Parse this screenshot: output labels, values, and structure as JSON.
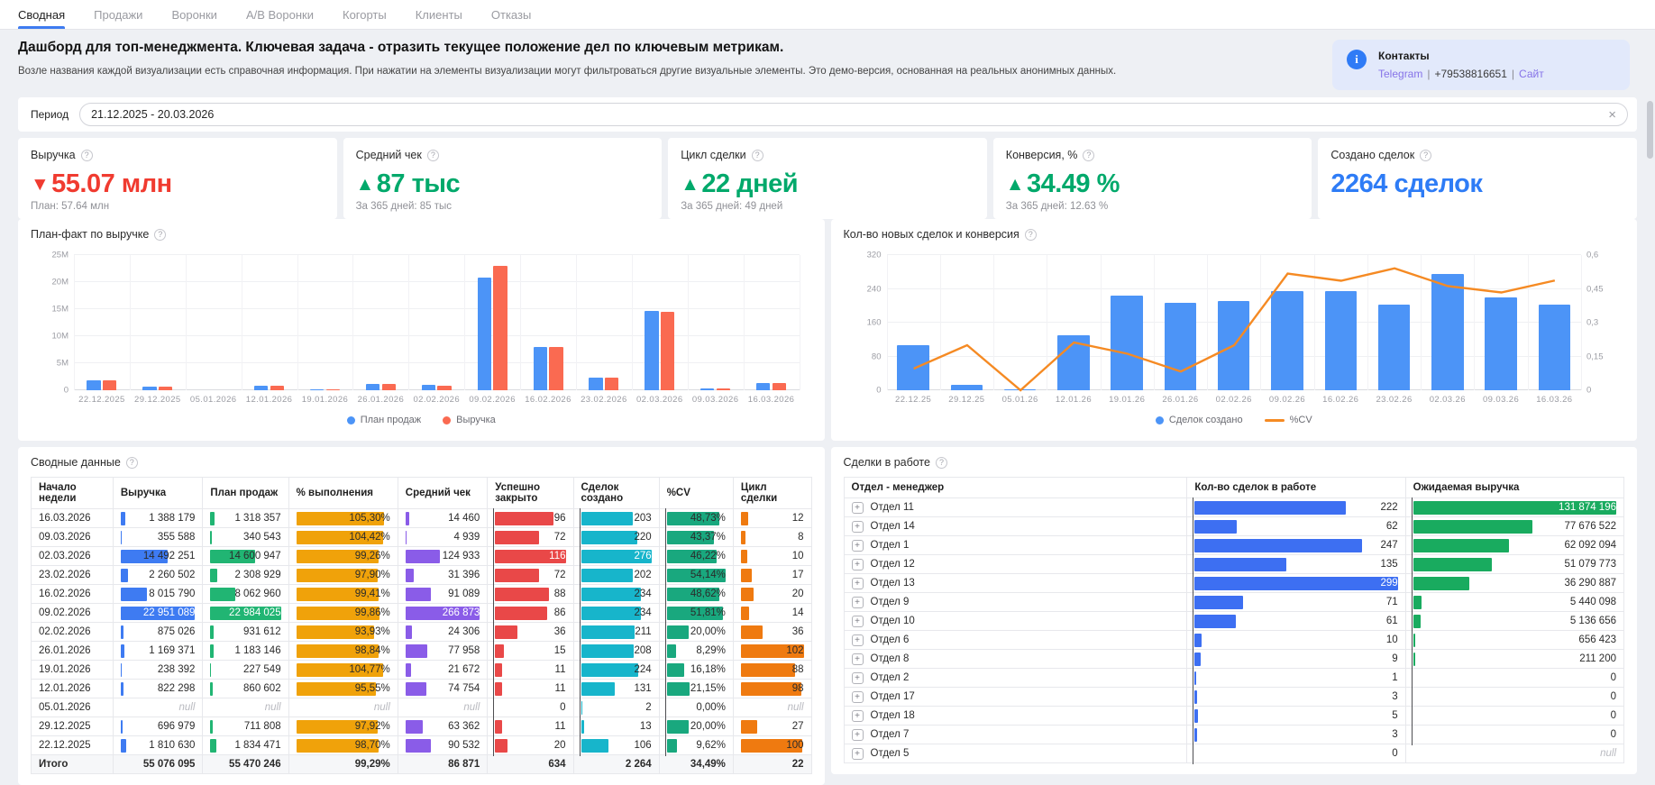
{
  "tabs": [
    {
      "id": "svodnaya",
      "label": "Сводная",
      "active": true
    },
    {
      "id": "prodazhi",
      "label": "Продажи",
      "active": false
    },
    {
      "id": "voronki",
      "label": "Воронки",
      "active": false
    },
    {
      "id": "ab-voronki",
      "label": "А/В Воронки",
      "active": false
    },
    {
      "id": "kogorty",
      "label": "Когорты",
      "active": false
    },
    {
      "id": "klienty",
      "label": "Клиенты",
      "active": false
    },
    {
      "id": "otkazy",
      "label": "Отказы",
      "active": false
    }
  ],
  "header": {
    "title": "Дашборд для топ-менеджмента. Ключевая задача - отразить текущее положение дел по ключевым метрикам.",
    "subtitle": "Возле названия каждой визуализации есть справочная информация. При нажатии на элементы визуализации могут фильтроваться другие визуальные элементы. Это демо-версия, основанная на реальных анонимных данных.",
    "contacts": {
      "title": "Контакты",
      "telegram": "Telegram",
      "phone": "+79538816651",
      "site": "Сайт"
    }
  },
  "filter": {
    "label": "Период",
    "value": "21.12.2025 - 20.03.2026"
  },
  "kpis": [
    {
      "id": "revenue",
      "title": "Выручка",
      "arrow": "▼",
      "value": "55.07 млн",
      "color": "#f03b30",
      "sub": "План: 57.64 млн"
    },
    {
      "id": "avg-check",
      "title": "Средний чек",
      "arrow": "▲",
      "value": "87 тыс",
      "color": "#00a96b",
      "sub": "За 365 дней: 85 тыс"
    },
    {
      "id": "deal-cycle",
      "title": "Цикл сделки",
      "arrow": "▲",
      "value": "22 дней",
      "color": "#00a96b",
      "sub": "За 365 дней: 49 дней"
    },
    {
      "id": "conversion",
      "title": "Конверсия, %",
      "arrow": "▲",
      "value": "34.49 %",
      "color": "#00a96b",
      "sub": "За 365 дней: 12.63 %"
    },
    {
      "id": "deals-created",
      "title": "Создано сделок",
      "arrow": "",
      "value": "2264 сделок",
      "color": "#2e7cf6",
      "sub": ""
    }
  ],
  "chart_data": [
    {
      "type": "bar",
      "title": "План-факт по выручке",
      "categories": [
        "22.12.2025",
        "29.12.2025",
        "05.01.2026",
        "12.01.2026",
        "19.01.2026",
        "26.01.2026",
        "02.02.2026",
        "09.02.2026",
        "16.02.2026",
        "23.02.2026",
        "02.03.2026",
        "09.03.2026",
        "16.03.2026"
      ],
      "series": [
        {
          "name": "План продаж",
          "kind": "bar",
          "color": "#4c94f7",
          "values": [
            1834471,
            711808,
            0,
            860602,
            227549,
            1183146,
            931612,
            20900000,
            8062960,
            2308929,
            14600947,
            340543,
            1318357
          ]
        },
        {
          "name": "Выручка",
          "kind": "bar",
          "color": "#fa6a51",
          "values": [
            1810630,
            696979,
            0,
            822298,
            238392,
            1169371,
            875026,
            22951089,
            8015790,
            2260502,
            14492251,
            355588,
            1388179
          ]
        }
      ],
      "ylim_left": [
        0,
        25000000
      ],
      "yticks_left": [
        "0",
        "5M",
        "10M",
        "15M",
        "20M",
        "25M"
      ],
      "grid": true,
      "legend_position": "bottom"
    },
    {
      "type": "bar+line",
      "title": "Кол-во новых сделок и конверсия",
      "categories": [
        "22.12.25",
        "29.12.25",
        "05.01.26",
        "12.01.26",
        "19.01.26",
        "26.01.26",
        "02.02.26",
        "09.02.26",
        "16.02.26",
        "23.02.26",
        "02.03.26",
        "09.03.26",
        "16.03.26"
      ],
      "series": [
        {
          "name": "Сделок создано",
          "kind": "bar",
          "color": "#4c94f7",
          "axis": "left",
          "values": [
            106,
            13,
            2,
            131,
            224,
            208,
            211,
            234,
            234,
            202,
            276,
            220,
            203
          ]
        },
        {
          "name": "%CV",
          "kind": "line",
          "color": "#f58a23",
          "axis": "right",
          "values": [
            0.096,
            0.2,
            0,
            0.212,
            0.162,
            0.083,
            0.2,
            0.518,
            0.486,
            0.541,
            0.462,
            0.434,
            0.487
          ]
        }
      ],
      "ylim_left": [
        0,
        320
      ],
      "yticks_left": [
        "0",
        "80",
        "160",
        "240",
        "320"
      ],
      "ylim_right": [
        0,
        0.6
      ],
      "yticks_right": [
        "0",
        "0,15",
        "0,3",
        "0,45",
        "0,6"
      ],
      "grid": true,
      "legend_position": "bottom"
    }
  ],
  "tables": {
    "summary": {
      "title": "Сводные данные",
      "columns": [
        "Начало недели",
        "Выручка",
        "План продаж",
        "% выполнения",
        "Средний чек",
        "Успешно закрыто",
        "Сделок создано",
        "%CV",
        "Цикл сделки"
      ],
      "rows": [
        [
          "16.03.2026",
          "1 388 179",
          "1 318 357",
          "105,30%",
          "14 460",
          "96",
          "203",
          "48,73%",
          "12"
        ],
        [
          "09.03.2026",
          "355 588",
          "340 543",
          "104,42%",
          "4 939",
          "72",
          "220",
          "43,37%",
          "8"
        ],
        [
          "02.03.2026",
          "14 492 251",
          "14 600 947",
          "99,26%",
          "124 933",
          "116",
          "276",
          "46,22%",
          "10"
        ],
        [
          "23.02.2026",
          "2 260 502",
          "2 308 929",
          "97,90%",
          "31 396",
          "72",
          "202",
          "54,14%",
          "17"
        ],
        [
          "16.02.2026",
          "8 015 790",
          "8 062 960",
          "99,41%",
          "91 089",
          "88",
          "234",
          "48,62%",
          "20"
        ],
        [
          "09.02.2026",
          "22 951 089",
          "22 984 025",
          "99,86%",
          "266 873",
          "86",
          "234",
          "51,81%",
          "14"
        ],
        [
          "02.02.2026",
          "875 026",
          "931 612",
          "93,93%",
          "24 306",
          "36",
          "211",
          "20,00%",
          "36"
        ],
        [
          "26.01.2026",
          "1 169 371",
          "1 183 146",
          "98,84%",
          "77 958",
          "15",
          "208",
          "8,29%",
          "102"
        ],
        [
          "19.01.2026",
          "238 392",
          "227 549",
          "104,77%",
          "21 672",
          "11",
          "224",
          "16,18%",
          "88"
        ],
        [
          "12.01.2026",
          "822 298",
          "860 602",
          "95,55%",
          "74 754",
          "11",
          "131",
          "21,15%",
          "98"
        ],
        [
          "05.01.2026",
          "null",
          "null",
          "null",
          "null",
          "0",
          "2",
          "0,00%",
          "null"
        ],
        [
          "29.12.2025",
          "696 979",
          "711 808",
          "97,92%",
          "63 362",
          "11",
          "13",
          "20,00%",
          "27"
        ],
        [
          "22.12.2025",
          "1 810 630",
          "1 834 471",
          "98,70%",
          "90 532",
          "20",
          "106",
          "9,62%",
          "100"
        ]
      ],
      "totals": [
        "Итого",
        "55 076 095",
        "55 470 246",
        "99,29%",
        "86 871",
        "634",
        "2 264",
        "34,49%",
        "22"
      ]
    },
    "deals": {
      "title": "Сделки в работе",
      "columns": [
        "Отдел - менеджер",
        "Кол-во сделок в работе",
        "Ожидаемая выручка"
      ],
      "rows": [
        [
          "Отдел 11",
          "222",
          "131 874 196"
        ],
        [
          "Отдел 14",
          "62",
          "77 676 522"
        ],
        [
          "Отдел 1",
          "247",
          "62 092 094"
        ],
        [
          "Отдел 12",
          "135",
          "51 079 773"
        ],
        [
          "Отдел 13",
          "299",
          "36 290 887"
        ],
        [
          "Отдел 9",
          "71",
          "5 440 098"
        ],
        [
          "Отдел 10",
          "61",
          "5 136 656"
        ],
        [
          "Отдел 6",
          "10",
          "656 423"
        ],
        [
          "Отдел 8",
          "9",
          "211 200"
        ],
        [
          "Отдел 2",
          "1",
          "0"
        ],
        [
          "Отдел 17",
          "3",
          "0"
        ],
        [
          "Отдел 18",
          "5",
          "0"
        ],
        [
          "Отдел 7",
          "3",
          "0"
        ],
        [
          "Отдел 5",
          "0",
          "null"
        ]
      ]
    }
  },
  "colors": {
    "accent_blue": "#3e7bf0",
    "bar_blue": "#4c94f7",
    "bar_coral": "#fa6a51",
    "line_orange": "#f58a23",
    "table_blue": "#3e7bf2",
    "table_green": "#21b573",
    "table_amber": "#f0a20a",
    "table_purple": "#8a5ce8",
    "table_red": "#e94848",
    "table_cyan": "#17b5cb",
    "table_teal": "#19a87e",
    "table_orange": "#ef7a10",
    "deals_blue": "#3d6ff2",
    "deals_green": "#19ab5f"
  }
}
